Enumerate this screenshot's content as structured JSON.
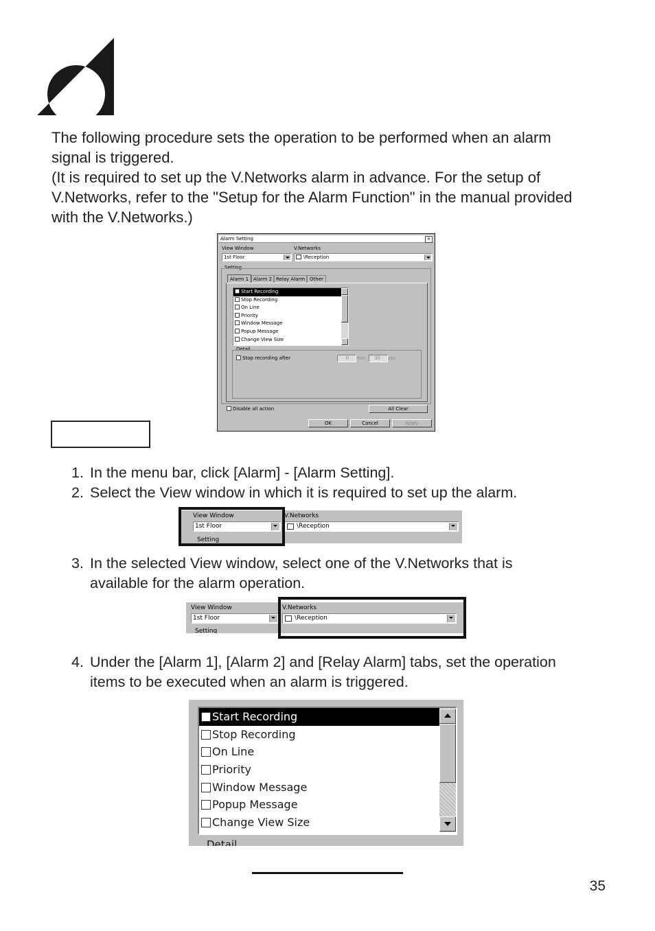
{
  "intro": {
    "line1": "The following procedure sets the operation to be performed when an alarm",
    "line2": "signal is triggered.",
    "line3": "(It is required to set up the V.Networks alarm in advance. For the setup of",
    "line4": "V.Networks, refer to the \"Setup for the Alarm Function\" in the manual provided",
    "line5": "with the V.Networks.)"
  },
  "dialog": {
    "title": "Alarm Setting",
    "close": "✕",
    "view_window_label": "View Window",
    "view_window_value": "1st Floor",
    "vnetworks_label": "V.Networks",
    "vnetworks_value": "\\Reception",
    "setting_label": "Setting",
    "tabs": [
      "Alarm 1",
      "Alarm 2",
      "Relay Alarm",
      "Other"
    ],
    "items": [
      "Start Recording",
      "Stop Recording",
      "On Line",
      "Priority",
      "Window Message",
      "Popup Message",
      "Change View Size"
    ],
    "detail_label": "Detail",
    "stop_recording_after": "Stop recording after",
    "min_value": "0",
    "min_unit": "min",
    "sec_value": "30",
    "sec_unit": "sec",
    "disable_all_action": "Disable all action",
    "all_clear": "All Clear",
    "ok": "OK",
    "cancel": "Cancel",
    "apply": "Apply"
  },
  "steps": {
    "s1_num": "1.",
    "s1": "In the menu bar, click [Alarm] - [Alarm Setting].",
    "s2_num": "2.",
    "s2": "Select the View window in which it is required to set up the alarm.",
    "s3_num": "3.",
    "s3a": "In the selected View window, select one of the V.Networks that is",
    "s3b": "available for the alarm operation.",
    "s4_num": "4.",
    "s4a": "Under the [Alarm 1], [Alarm 2] and [Relay Alarm] tabs, set the operation",
    "s4b": "items to be executed when an alarm is triggered."
  },
  "crop1": {
    "view_window_label": "View Window",
    "view_window_value": "1st Floor",
    "vnetworks_label": "V.Networks",
    "vnetworks_value": "\\Reception",
    "setting_label": "Setting"
  },
  "crop2": {
    "view_window_label": "View Window",
    "view_window_value": "1st Floor",
    "vnetworks_label": "V.Networks",
    "vnetworks_value": "\\Reception",
    "setting_label": "Setting"
  },
  "crop3": {
    "items": [
      "Start Recording",
      "Stop Recording",
      "On Line",
      "Priority",
      "Window Message",
      "Popup Message",
      "Change View Size"
    ],
    "detail_label": "Detail"
  },
  "page_number": "35",
  "icons": [
    "logo-mark",
    "close-icon",
    "dropdown-arrow-icon",
    "network-icon",
    "scroll-up-icon",
    "scroll-down-icon"
  ]
}
